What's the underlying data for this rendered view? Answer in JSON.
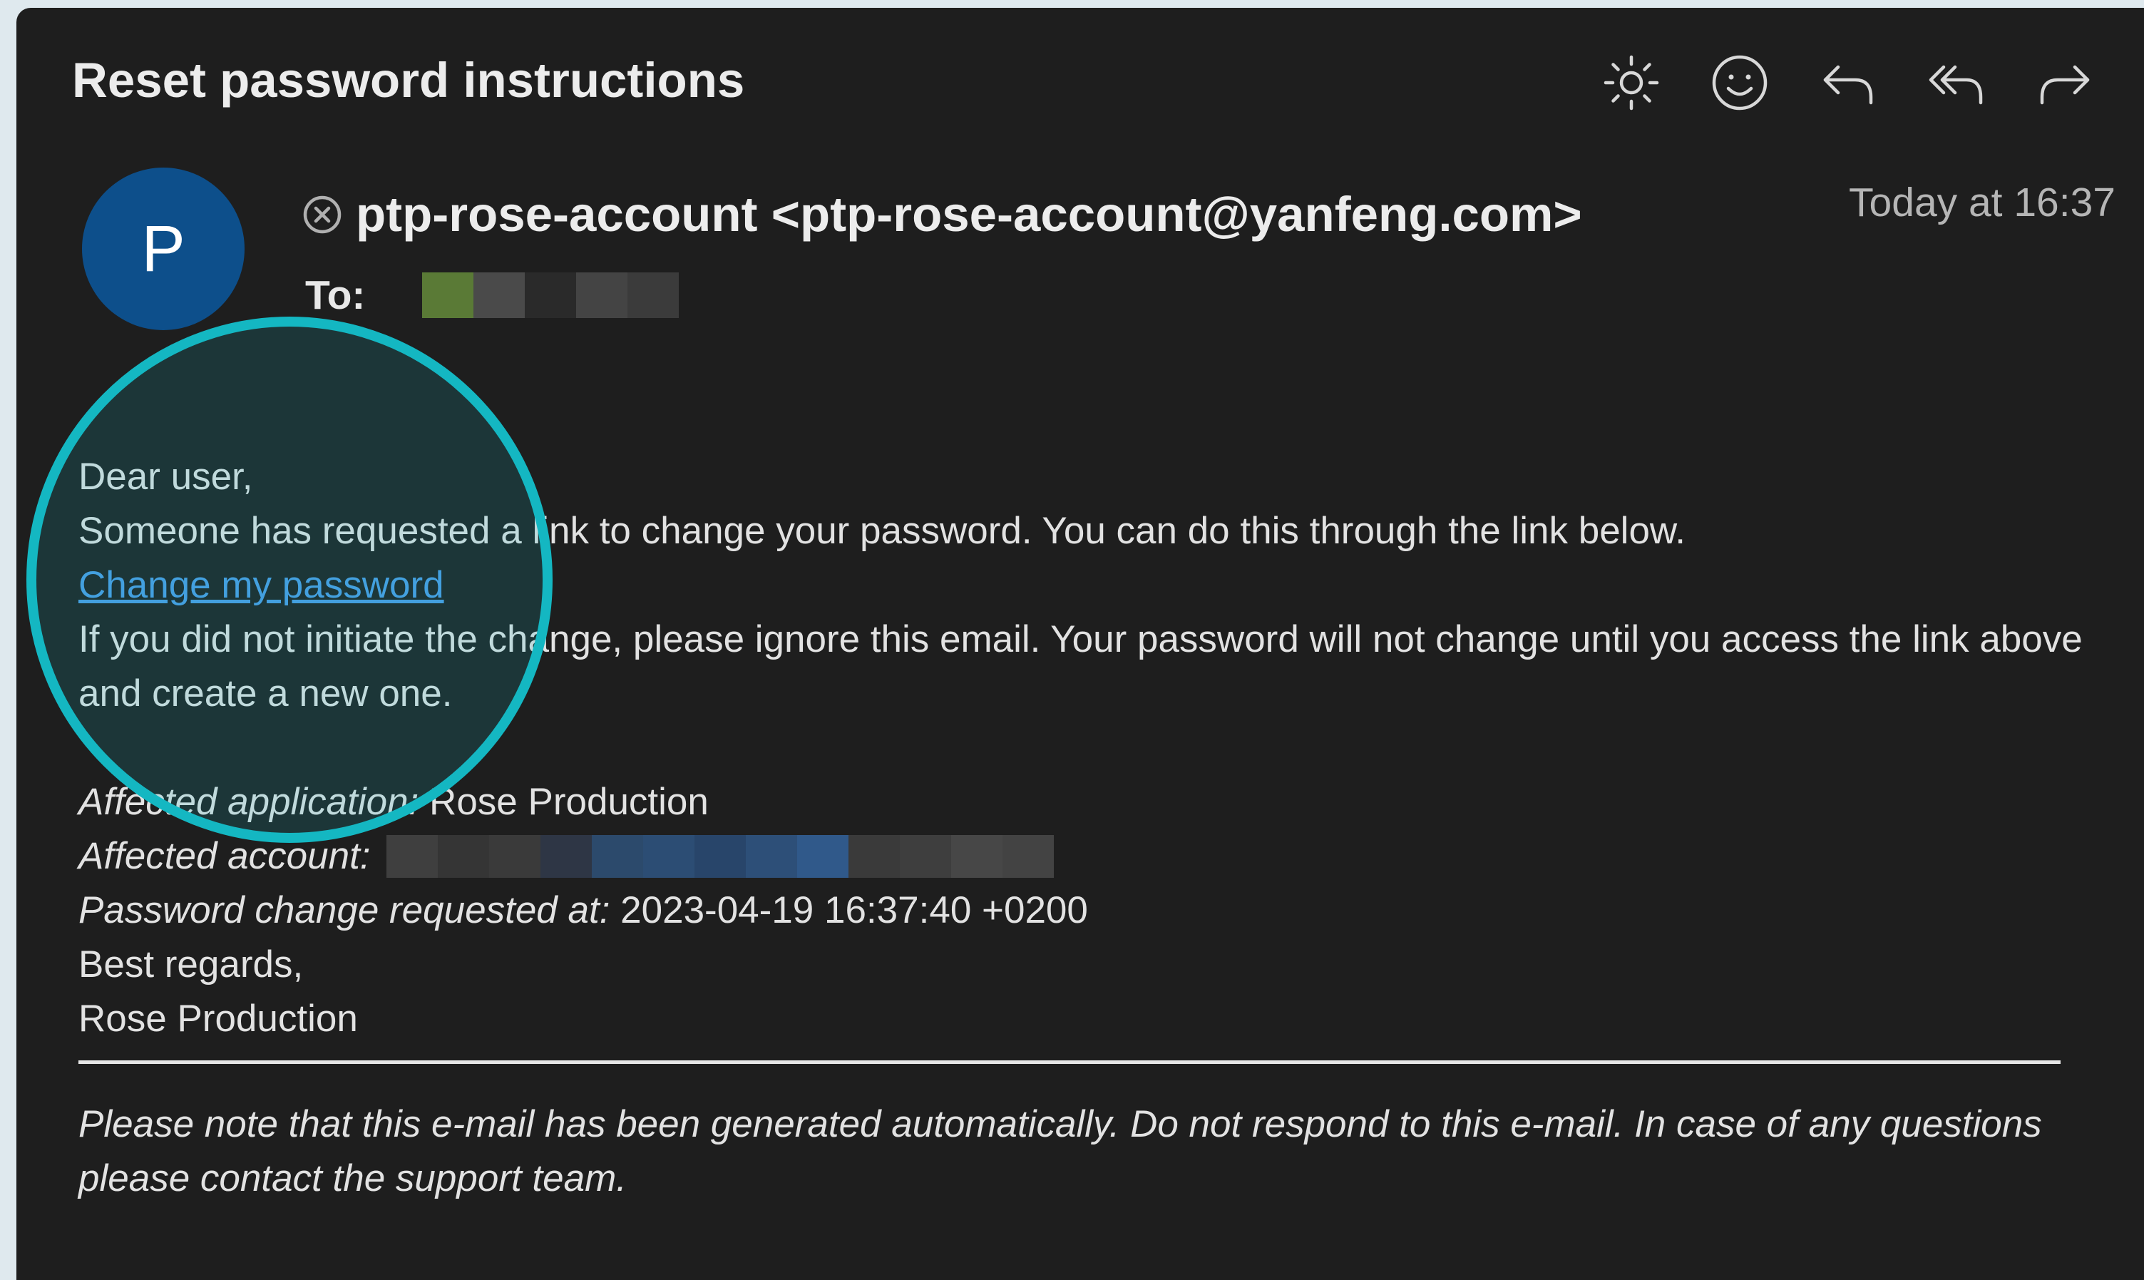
{
  "email": {
    "subject": "Reset password instructions",
    "sender": {
      "avatar_initial": "P",
      "display": "ptp-rose-account <ptp-rose-account@yanfeng.com>"
    },
    "to_label": "To:",
    "date": "Today at 16:37",
    "body": {
      "greeting": "Dear user,",
      "intro": "Someone has requested a link to change your password. You can do this through the link below.",
      "link_text": "Change my password",
      "notice": "If you did not initiate the change, please ignore this email. Your password will not change until you access the link above and create a new one.",
      "application_label": "Affected application:",
      "application_value": "Rose Production",
      "account_label": "Affected account:",
      "requested_at_label": "Password change requested at:",
      "requested_at_value": "2023-04-19 16:37:40 +0200",
      "closing": "Best regards,",
      "signature": "Rose Production"
    },
    "disclaimer": "Please note that this e-mail has been generated automatically. Do not respond to this e-mail. In case of any questions please contact the support team."
  },
  "toolbar": {
    "icons": [
      "sun-icon",
      "emoji-icon",
      "reply-icon",
      "reply-all-icon",
      "forward-icon"
    ]
  },
  "colors": {
    "background": "#1e1e1e",
    "avatar": "#0d4f8b",
    "link": "#4d9ce5",
    "highlight_ring": "#14b7c2",
    "text": "#e2e2e2",
    "muted": "#b5b5b5"
  }
}
